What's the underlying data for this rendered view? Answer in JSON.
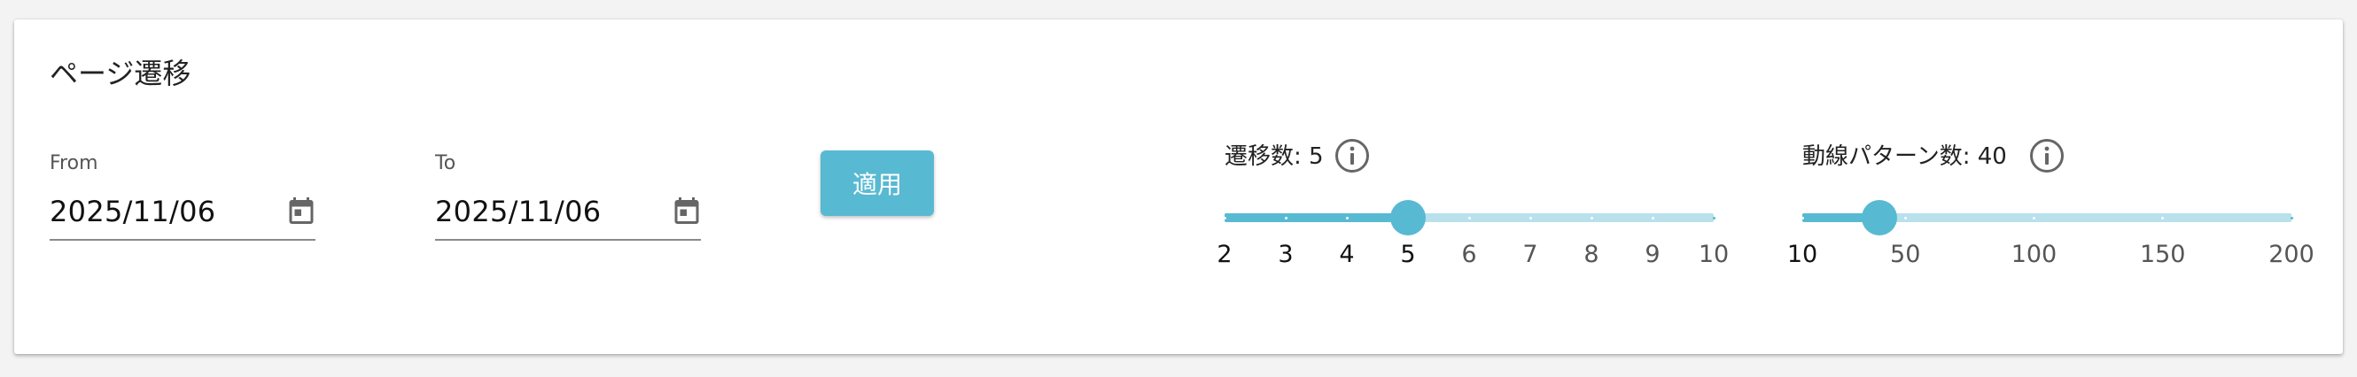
{
  "panel": {
    "title": "ページ遷移"
  },
  "from": {
    "label": "From",
    "value": "2025/11/06",
    "icon": "calendar-icon"
  },
  "to": {
    "label": "To",
    "value": "2025/11/06",
    "icon": "calendar-icon"
  },
  "apply": {
    "label": "適用"
  },
  "colors": {
    "accent": "#58b9d2",
    "track": "#b8e1ec",
    "background": "#f3f3f3"
  },
  "transition_slider": {
    "label": "遷移数: 5",
    "icon": "info-icon",
    "min": 2,
    "max": 10,
    "value": 5,
    "ticks": [
      "2",
      "3",
      "4",
      "5",
      "6",
      "7",
      "8",
      "9",
      "10"
    ]
  },
  "pattern_slider": {
    "label": "動線パターン数: 40",
    "icon": "info-icon",
    "min": 10,
    "max": 200,
    "value": 40,
    "ticks": [
      "10",
      "50",
      "100",
      "150",
      "200"
    ]
  }
}
